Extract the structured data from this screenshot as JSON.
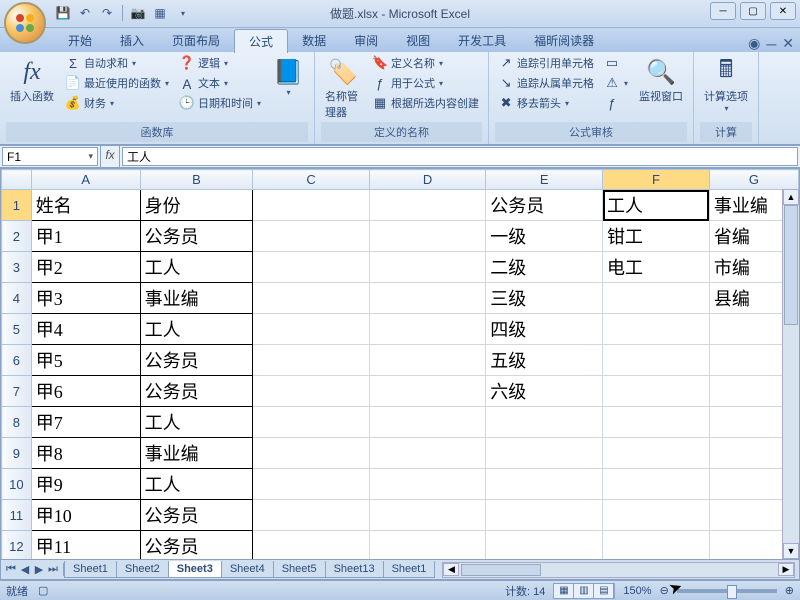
{
  "title": "做题.xlsx - Microsoft Excel",
  "qat": {
    "save": "💾",
    "undo": "↶",
    "redo": "↷",
    "camera": "📷",
    "grid": "▦"
  },
  "tabs": [
    "开始",
    "插入",
    "页面布局",
    "公式",
    "数据",
    "审阅",
    "视图",
    "开发工具",
    "福昕阅读器"
  ],
  "active_tab_index": 3,
  "ribbon": {
    "insert_fn": "插入函数",
    "autosum": "自动求和",
    "recent": "最近使用的函数",
    "financial": "财务",
    "logical": "逻辑",
    "text": "文本",
    "datetime": "日期和时间",
    "group_lib": "函数库",
    "name_mgr": "名称管理器",
    "define_name": "定义名称",
    "use_in_formula": "用于公式",
    "create_from_sel": "根据所选内容创建",
    "group_names": "定义的名称",
    "trace_prec": "追踪引用单元格",
    "trace_dep": "追踪从属单元格",
    "remove_arrows": "移去箭头",
    "group_audit": "公式审核",
    "watch": "监视窗口",
    "calc_opts": "计算选项",
    "group_calc": "计算"
  },
  "name_box": "F1",
  "formula_value": "工人",
  "columns": [
    "A",
    "B",
    "C",
    "D",
    "E",
    "F",
    "G"
  ],
  "active_cell": {
    "row": 1,
    "col": "F"
  },
  "rows": [
    {
      "n": 1,
      "A": "姓名",
      "B": "身份",
      "E": "公务员",
      "F": "工人",
      "G": "事业编"
    },
    {
      "n": 2,
      "A": "甲1",
      "B": "公务员",
      "E": "一级",
      "F": "钳工",
      "G": "省编"
    },
    {
      "n": 3,
      "A": "甲2",
      "B": "工人",
      "E": "二级",
      "F": "电工",
      "G": "市编"
    },
    {
      "n": 4,
      "A": "甲3",
      "B": "事业编",
      "E": "三级",
      "F": "",
      "G": "县编"
    },
    {
      "n": 5,
      "A": "甲4",
      "B": "工人",
      "E": "四级",
      "F": "",
      "G": ""
    },
    {
      "n": 6,
      "A": "甲5",
      "B": "公务员",
      "E": "五级",
      "F": "",
      "G": ""
    },
    {
      "n": 7,
      "A": "甲6",
      "B": "公务员",
      "E": "六级",
      "F": "",
      "G": ""
    },
    {
      "n": 8,
      "A": "甲7",
      "B": "工人",
      "E": "",
      "F": "",
      "G": ""
    },
    {
      "n": 9,
      "A": "甲8",
      "B": "事业编",
      "E": "",
      "F": "",
      "G": ""
    },
    {
      "n": 10,
      "A": "甲9",
      "B": "工人",
      "E": "",
      "F": "",
      "G": ""
    },
    {
      "n": 11,
      "A": "甲10",
      "B": "公务员",
      "E": "",
      "F": "",
      "G": ""
    },
    {
      "n": 12,
      "A": "甲11",
      "B": "公务员",
      "E": "",
      "F": "",
      "G": ""
    }
  ],
  "bordered_range": {
    "cols": [
      "A",
      "B"
    ],
    "rows_from": 1,
    "rows_to": 12
  },
  "sheet_tabs": [
    "Sheet1",
    "Sheet2",
    "Sheet3",
    "Sheet4",
    "Sheet5",
    "Sheet13",
    "Sheet1"
  ],
  "active_sheet_index": 2,
  "status": {
    "ready": "就绪",
    "count": "计数: 14",
    "zoom": "150%"
  }
}
